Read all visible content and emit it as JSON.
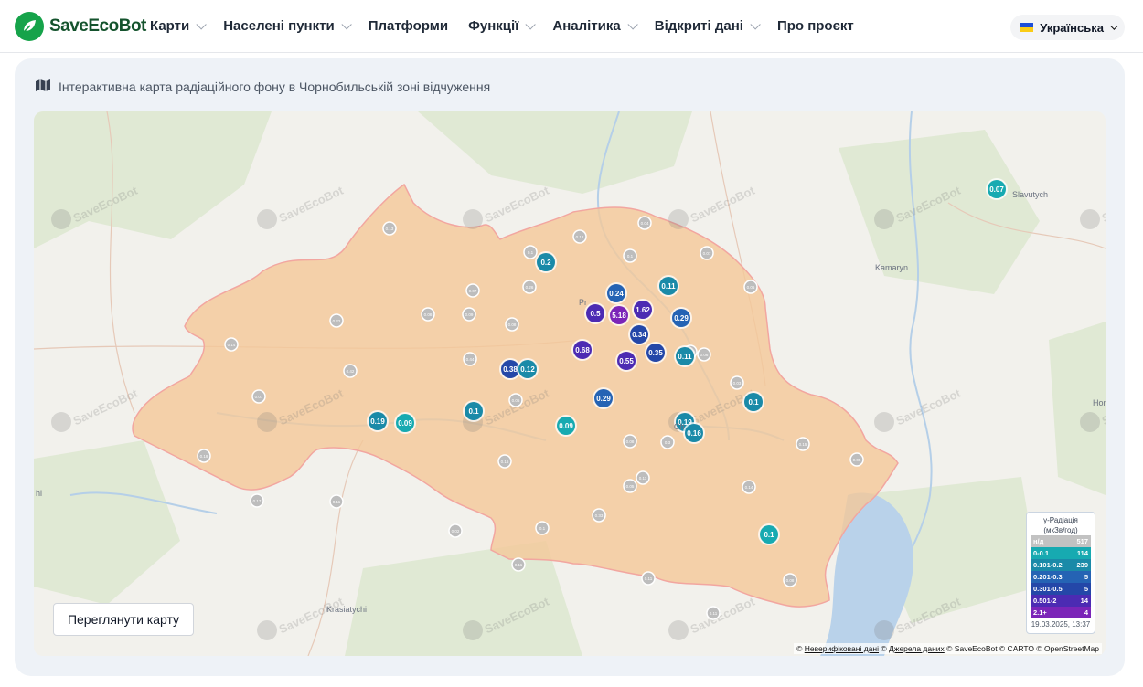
{
  "header": {
    "logo_text": "SaveEcoBot",
    "nav": [
      {
        "label": "Карти",
        "has_dropdown": true
      },
      {
        "label": "Населені пункти",
        "has_dropdown": true
      },
      {
        "label": "Платформи",
        "has_dropdown": false
      },
      {
        "label": "Функції",
        "has_dropdown": true
      },
      {
        "label": "Аналітика",
        "has_dropdown": true
      },
      {
        "label": "Відкриті дані",
        "has_dropdown": true
      },
      {
        "label": "Про проєкт",
        "has_dropdown": false
      }
    ],
    "language": "Українська"
  },
  "card": {
    "title": "Інтерактивна карта радіаційного фону в Чорнобильській зоні відчуження",
    "view_map_button": "Переглянути карту"
  },
  "map": {
    "watermark": "SaveEcoBot",
    "places": [
      "Slavutych",
      "Kamaryn",
      "Honch",
      "Krasiatychi",
      "Pr",
      "Ch",
      "hi"
    ],
    "markers_labeled": [
      {
        "value": "0.2",
        "level": "0.101-0.2"
      },
      {
        "value": "0.24",
        "level": "0.201-0.3"
      },
      {
        "value": "0.11",
        "level": "0.101-0.2"
      },
      {
        "value": "1.62",
        "level": "0.501-2"
      },
      {
        "value": "5.18",
        "level": "2.1+"
      },
      {
        "value": "0.5",
        "level": "0.501-2"
      },
      {
        "value": "0.34",
        "level": "0.301-0.5"
      },
      {
        "value": "0.29",
        "level": "0.201-0.3"
      },
      {
        "value": "0.68",
        "level": "0.501-2"
      },
      {
        "value": "0.35",
        "level": "0.301-0.5"
      },
      {
        "value": "0.55",
        "level": "0.501-2"
      },
      {
        "value": "0.11",
        "level": "0.101-0.2"
      },
      {
        "value": "0.38",
        "level": "0.301-0.5"
      },
      {
        "value": "0.12",
        "level": "0.101-0.2"
      },
      {
        "value": "0.29",
        "level": "0.201-0.3"
      },
      {
        "value": "0.1",
        "level": "0.101-0.2"
      },
      {
        "value": "0.1",
        "level": "0.101-0.2"
      },
      {
        "value": "0.19",
        "level": "0.101-0.2"
      },
      {
        "value": "0.09",
        "level": "0-0.1"
      },
      {
        "value": "0.09",
        "level": "0-0.1"
      },
      {
        "value": "0.19",
        "level": "0.101-0.2"
      },
      {
        "value": "0.16",
        "level": "0.101-0.2"
      },
      {
        "value": "0.1",
        "level": "0-0.1"
      },
      {
        "value": "0.07",
        "level": "0-0.1"
      }
    ],
    "unverified_markers": [
      "0.13",
      "0.1",
      "0.12",
      "0.04",
      "0.1",
      "0.07",
      "0.07",
      "0.26",
      "0.06",
      "0.22",
      "0.08",
      "0.09",
      "0.08",
      "0.14",
      "0.42",
      "0.44",
      "0.08",
      "0.05",
      "0.06",
      "0.03",
      "0.19",
      "0.16",
      "0.08",
      "0.3",
      "0.11",
      "0.14",
      "0.17",
      "0.11",
      "0.1",
      "0.33",
      "0.05",
      "0.15",
      "0.08",
      "0.11",
      "0.11",
      "0.11",
      "0.02",
      "0.07",
      "0.05"
    ]
  },
  "legend": {
    "title_line1": "γ-Радіація",
    "title_line2": "(мкЗв/год)",
    "rows": [
      {
        "label": "н/д",
        "count": "517",
        "color": "#c2c2c2"
      },
      {
        "label": "0-0.1",
        "count": "114",
        "color": "#17aab1"
      },
      {
        "label": "0.101-0.2",
        "count": "239",
        "color": "#1a8aa8"
      },
      {
        "label": "0.201-0.3",
        "count": "5",
        "color": "#2563b4"
      },
      {
        "label": "0.301-0.5",
        "count": "5",
        "color": "#2447a8"
      },
      {
        "label": "0.501-2",
        "count": "14",
        "color": "#4c2bb3"
      },
      {
        "label": "2.1+",
        "count": "4",
        "color": "#7b25b8"
      }
    ],
    "date": "19.03.2025, 13:37"
  },
  "attribution": {
    "copy": "©",
    "unverified": "Неверифіковані дані",
    "sources": "Джерела даних",
    "rest": "© SaveEcoBot © CARTO © OpenStreetMap"
  },
  "colors": {
    "zone_fill": "#f4c898",
    "zone_stroke": "#f2a6a0",
    "water": "#b5cfe8",
    "forest": "#d9e6cc",
    "accent": "#16a34a"
  }
}
